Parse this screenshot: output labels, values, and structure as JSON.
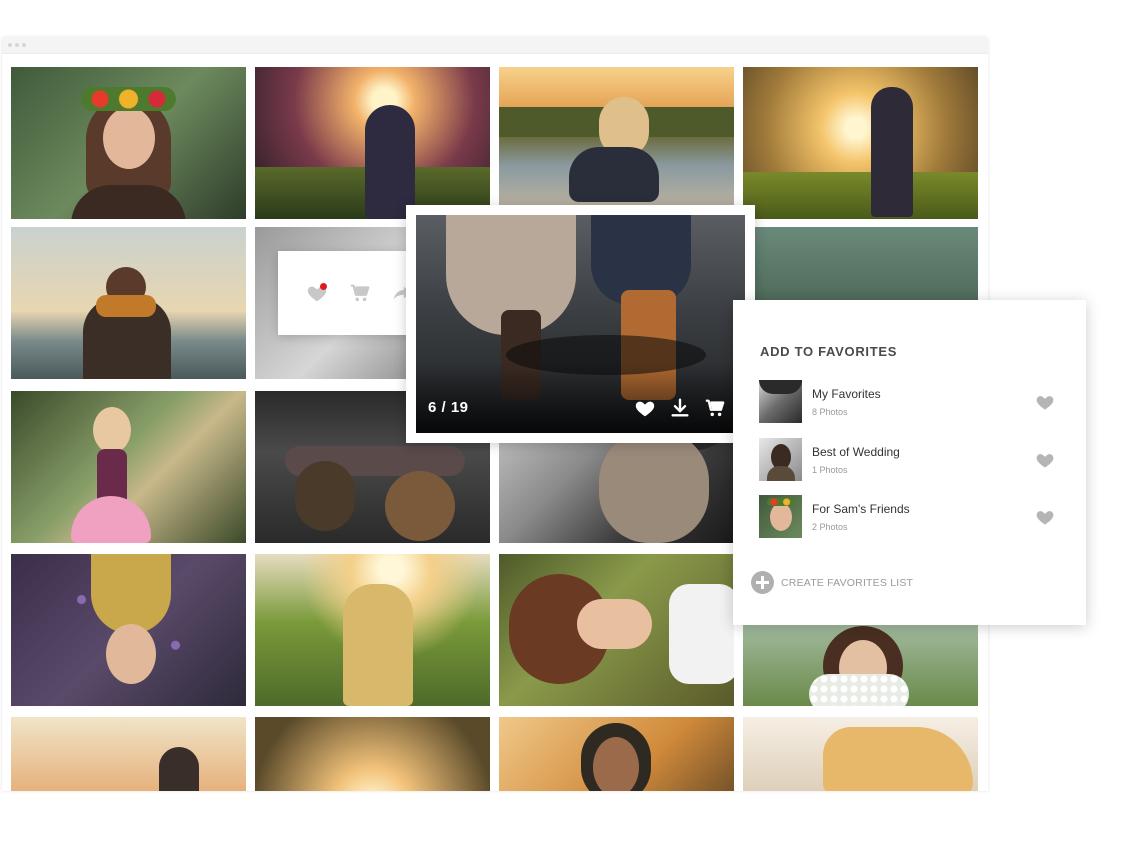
{
  "toolbar": {
    "icons": [
      "heart-icon",
      "cart-icon",
      "share-icon",
      "search-icon",
      "more-vertical-icon"
    ],
    "notification_color": "#e0191e",
    "icon_color": "#c8c8c8"
  },
  "preview": {
    "counter": "6 / 19",
    "icons": [
      "heart-icon",
      "download-icon",
      "cart-icon"
    ]
  },
  "favorites": {
    "title": "ADD TO FAVORITES",
    "lists": [
      {
        "name": "My Favorites",
        "count": "8 Photos"
      },
      {
        "name": "Best of Wedding",
        "count": "1 Photos"
      },
      {
        "name": "For Sam's Friends",
        "count": "2 Photos"
      }
    ],
    "create_label": "CREATE FAVORITES LIST"
  },
  "colors": {
    "heart_gray": "#b5b5b5",
    "title_text": "#4a4a4a",
    "muted_text": "#9a9a9a"
  }
}
